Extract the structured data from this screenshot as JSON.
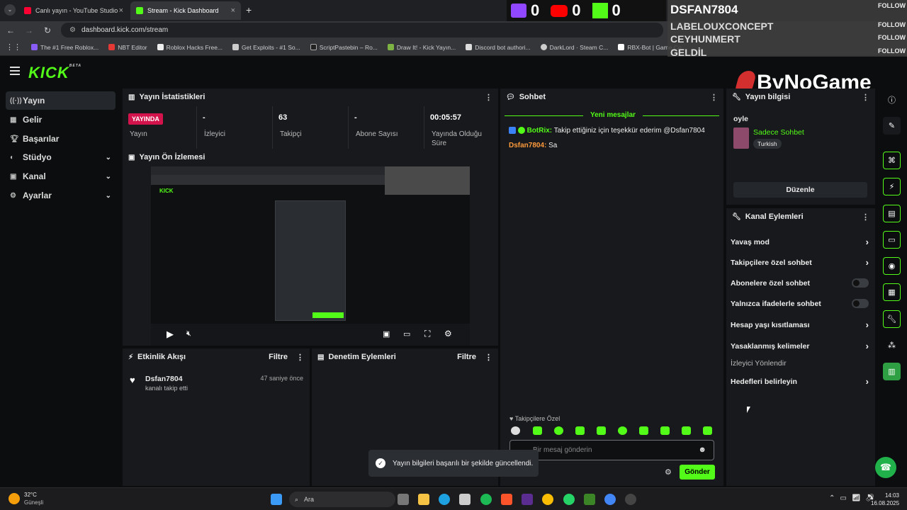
{
  "browser": {
    "tabs": [
      {
        "title": "Canlı yayın - YouTube Studio",
        "color": "#ff0033"
      },
      {
        "title": "Stream - Kick Dashboard",
        "color": "#53fc18"
      }
    ],
    "url": "dashboard.kick.com/stream",
    "bookmarks": [
      "The #1 Free Roblox...",
      "NBT Editor",
      "Roblox Hacks Free...",
      "Get Exploits - #1 So...",
      "ScriptPastebin – Ro...",
      "Draw It! - Kick Yayın...",
      "Discord bot authori...",
      "DarkLord · Steam C...",
      "RBX-Bot | Game Co..."
    ]
  },
  "overlay": {
    "counts": {
      "twitch": "0",
      "youtube": "0",
      "kick": "0"
    },
    "names": [
      "DSFAN7804",
      "LABELOUXCONCEPT",
      "CEYHUNMERT",
      "GELDİL"
    ],
    "follow_label": "FOLLOW",
    "watermark": "ByNoGame"
  },
  "sidebar": {
    "items": [
      {
        "label": "Yayın",
        "icon": "broadcast-icon"
      },
      {
        "label": "Gelir",
        "icon": "money-icon"
      },
      {
        "label": "Başarılar",
        "icon": "trophy-icon"
      },
      {
        "label": "Stüdyo",
        "icon": "studio-icon"
      },
      {
        "label": "Kanal",
        "icon": "channel-icon"
      },
      {
        "label": "Ayarlar",
        "icon": "gear-icon"
      }
    ]
  },
  "stats": {
    "title": "Yayın İstatistikleri",
    "live_badge": "YAYINDA",
    "items": [
      {
        "value": "",
        "label": "Yayın"
      },
      {
        "value": "-",
        "label": "İzleyici"
      },
      {
        "value": "63",
        "label": "Takipçi"
      },
      {
        "value": "-",
        "label": "Abone Sayısı"
      },
      {
        "value": "00:05:57",
        "label": "Yayında Olduğu Süre"
      }
    ]
  },
  "preview": {
    "title": "Yayın Ön İzlemesi"
  },
  "activity": {
    "title": "Etkinlik Akışı",
    "filter": "Filtre",
    "event": {
      "user": "Dsfan7804",
      "text": "kanalı takip etti",
      "time": "47 saniye önce"
    }
  },
  "moderation": {
    "title": "Denetim Eylemleri",
    "filter": "Filtre"
  },
  "chat": {
    "title": "Sohbet",
    "new_messages": "Yeni mesajlar",
    "messages": [
      {
        "user": "BotRix:",
        "text": "Takip ettiğiniz için teşekkür ederim @Dsfan7804"
      },
      {
        "user": "Dsfan7804:",
        "text": "Sa"
      }
    ],
    "followers_only": "Takipçilere Özel",
    "input_placeholder": "Bir mesaj gönderin",
    "send": "Gönder"
  },
  "stream_info": {
    "title": "Yayın bilgisi",
    "stream_title": "oyle",
    "category": "Sadece Sohbet",
    "language": "Turkish",
    "edit": "Düzenle"
  },
  "channel_actions": {
    "title": "Kanal Eylemleri",
    "items": [
      {
        "label": "Yavaş mod",
        "kind": "chevron"
      },
      {
        "label": "Takipçilere özel sohbet",
        "kind": "chevron"
      },
      {
        "label": "Abonelere özel sohbet",
        "kind": "toggle"
      },
      {
        "label": "Yalnızca ifadelerle sohbet",
        "kind": "toggle"
      },
      {
        "label": "Hesap yaşı kısıtlaması",
        "kind": "chevron"
      },
      {
        "label": "Yasaklanmış kelimeler",
        "kind": "chevron"
      },
      {
        "label": "İzleyici Yönlendir",
        "kind": "none"
      },
      {
        "label": "Hedefleri belirleyin",
        "kind": "chevron"
      }
    ]
  },
  "toast": "Yayın bilgileri başarılı bir şekilde güncellendi.",
  "taskbar": {
    "weather_temp": "32°C",
    "weather_desc": "Güneşli",
    "search": "Ara",
    "time": "14:03",
    "date": "16.08.2025"
  },
  "colors": {
    "kick_green": "#53fc18",
    "live_red": "#d3134b"
  }
}
